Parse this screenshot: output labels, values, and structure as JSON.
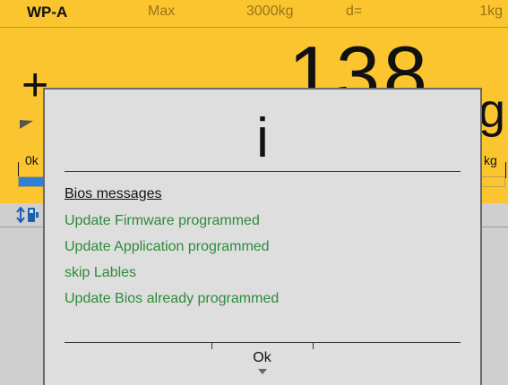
{
  "header": {
    "scale_name": "WP-A",
    "max_label": "Max",
    "capacity": "3000kg",
    "d_label": "d=",
    "division": "1kg"
  },
  "display": {
    "sign": "+",
    "weight": "138",
    "unit": "g",
    "bar_left_label": "0k",
    "bar_right_label": "kg",
    "bar_fill_fraction": 0.05
  },
  "status": {
    "icon": "usb-transfer-icon"
  },
  "dialog": {
    "icon": "i",
    "title": "Bios messages",
    "messages": [
      "Update Firmware programmed",
      "Update Application programmed",
      "skip Lables",
      "Update Bios already programmed"
    ],
    "ok_label": "Ok"
  },
  "colors": {
    "display_background": "#fbc52f",
    "dialog_background": "#dedede",
    "message_text": "#2e8b3a",
    "bar_fill": "#2f7fd6"
  }
}
